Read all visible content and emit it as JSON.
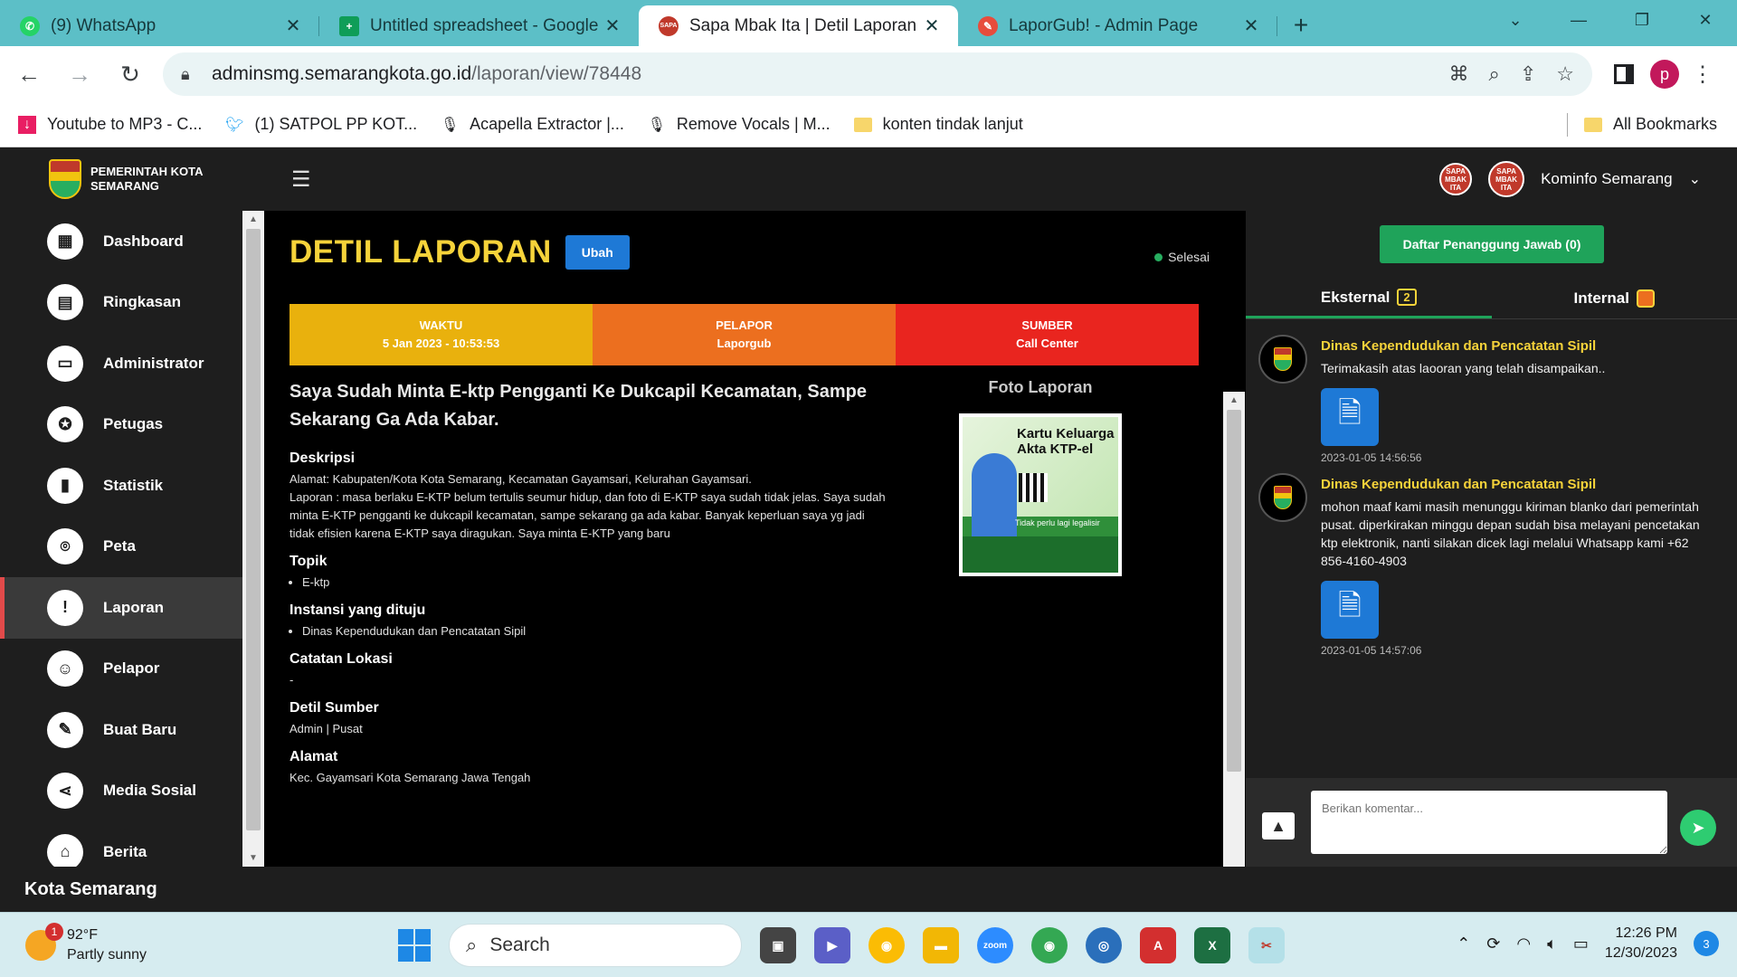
{
  "browser": {
    "tabs": [
      {
        "title": "(9) WhatsApp",
        "icon": "whatsapp-icon",
        "color": "#25d366"
      },
      {
        "title": "Untitled spreadsheet - Google S",
        "icon": "sheets-icon",
        "color": "#0f9d58"
      },
      {
        "title": "Sapa Mbak Ita | Detil Laporan",
        "icon": "sapa-icon",
        "color": "#c0392b"
      },
      {
        "title": "LaporGub! - Admin Page",
        "icon": "laporgub-icon",
        "color": "#e74c3c"
      }
    ],
    "url_host": "adminsmg.semarangkota.go.id",
    "url_path": "/laporan/view/78448",
    "profile_initial": "p",
    "bookmarks": [
      {
        "label": "Youtube to MP3 - C...",
        "icon": "download-icon"
      },
      {
        "label": "(1) SATPOL PP KOT...",
        "icon": "twitter-icon"
      },
      {
        "label": "Acapella Extractor |...",
        "icon": "mic-icon"
      },
      {
        "label": "Remove Vocals | M...",
        "icon": "mic-icon"
      },
      {
        "label": "konten tindak lanjut",
        "icon": "folder-icon"
      }
    ],
    "all_bookmarks": "All Bookmarks"
  },
  "app": {
    "brand_line1": "PEMERINTAH KOTA",
    "brand_line2": "SEMARANG",
    "user": "Kominfo Semarang",
    "sidebar": [
      {
        "label": "Dashboard",
        "icon": "dashboard-icon"
      },
      {
        "label": "Ringkasan",
        "icon": "summary-icon"
      },
      {
        "label": "Administrator",
        "icon": "monitor-icon"
      },
      {
        "label": "Petugas",
        "icon": "badge-icon"
      },
      {
        "label": "Statistik",
        "icon": "chart-icon"
      },
      {
        "label": "Peta",
        "icon": "map-pin-icon"
      },
      {
        "label": "Laporan",
        "icon": "report-icon"
      },
      {
        "label": "Pelapor",
        "icon": "users-icon"
      },
      {
        "label": "Buat Baru",
        "icon": "pencil-icon"
      },
      {
        "label": "Media Sosial",
        "icon": "share-icon"
      },
      {
        "label": "Berita",
        "icon": "news-icon"
      }
    ],
    "active_sidebar": "Laporan",
    "footer": "Kota Semarang"
  },
  "report": {
    "title": "DETIL LAPORAN",
    "edit_label": "Ubah",
    "status": "Selesai",
    "info": {
      "waktu_label": "WAKTU",
      "waktu_value": "5 Jan 2023 - 10:53:53",
      "pelapor_label": "PELAPOR",
      "pelapor_value": "Laporgub",
      "sumber_label": "SUMBER",
      "sumber_value": "Call Center"
    },
    "headline": "Saya Sudah Minta E-ktp Pengganti Ke Dukcapil Kecamatan, Sampe Sekarang Ga Ada Kabar.",
    "deskripsi_label": "Deskripsi",
    "deskripsi_line1": "Alamat: Kabupaten/Kota Kota Semarang, Kecamatan Gayamsari, Kelurahan Gayamsari.",
    "deskripsi_line2": "Laporan : masa berlaku E-KTP belum tertulis seumur hidup, dan foto di E-KTP saya sudah tidak jelas. Saya sudah minta E-KTP pengganti ke dukcapil kecamatan, sampe sekarang ga ada kabar. Banyak keperluan saya yg jadi tidak efisien karena E-KTP saya diragukan. Saya minta E-KTP yang baru",
    "topik_label": "Topik",
    "topik_value": "E-ktp",
    "instansi_label": "Instansi yang dituju",
    "instansi_value": "Dinas Kependudukan dan Pencatatan Sipil",
    "catatan_label": "Catatan Lokasi",
    "catatan_value": "-",
    "detil_sumber_label": "Detil Sumber",
    "detil_sumber_value": "Admin | Pusat",
    "alamat_label": "Alamat",
    "alamat_value": "Kec. Gayamsari Kota Semarang Jawa Tengah",
    "photo_label": "Foto Laporan",
    "photo_text": "Kartu Keluarga Akta KTP-el",
    "photo_sub": "Tidak perlu lagi legalisir"
  },
  "panel": {
    "daftar_label": "Daftar Penanggung Jawab (0)",
    "tab_external": "Eksternal",
    "tab_external_count": "2",
    "tab_internal": "Internal",
    "comments": [
      {
        "author": "Dinas Kependudukan dan Pencatatan Sipil",
        "text": "Terimakasih atas laooran yang telah disampaikan..",
        "time": "2023-01-05 14:56:56"
      },
      {
        "author": "Dinas Kependudukan dan Pencatatan Sipil",
        "text": "mohon maaf kami masih menunggu kiriman blanko dari pemerintah pusat. diperkirakan minggu depan sudah bisa melayani pencetakan ktp elektronik, nanti silakan dicek lagi melalui Whatsapp kami +62 856-4160-4903",
        "time": "2023-01-05 14:57:06"
      }
    ],
    "comment_placeholder": "Berikan komentar..."
  },
  "taskbar": {
    "temperature": "92°F",
    "weather": "Partly sunny",
    "weather_badge": "1",
    "search": "Search",
    "time": "12:26 PM",
    "date": "12/30/2023",
    "notifications": "3"
  }
}
